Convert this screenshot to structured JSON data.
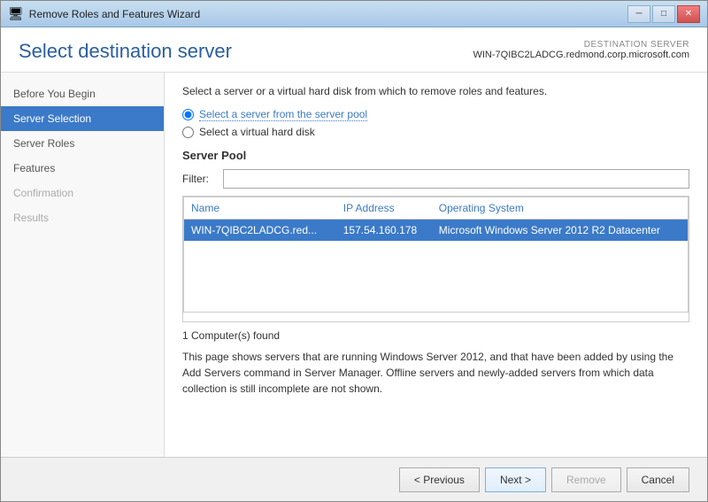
{
  "window": {
    "title": "Remove Roles and Features Wizard",
    "controls": {
      "minimize": "─",
      "maximize": "□",
      "close": "✕"
    }
  },
  "header": {
    "page_title": "Select destination server",
    "destination_label": "DESTINATION SERVER",
    "destination_name": "WIN-7QIBC2LADCG.redmond.corp.microsoft.com"
  },
  "sidebar": {
    "items": [
      {
        "label": "Before You Begin",
        "state": "normal"
      },
      {
        "label": "Server Selection",
        "state": "active"
      },
      {
        "label": "Server Roles",
        "state": "normal"
      },
      {
        "label": "Features",
        "state": "normal"
      },
      {
        "label": "Confirmation",
        "state": "disabled"
      },
      {
        "label": "Results",
        "state": "disabled"
      }
    ]
  },
  "content": {
    "description": "Select a server or a virtual hard disk from which to remove roles and features.",
    "radio_options": [
      {
        "id": "radio-pool",
        "label": "Select a server from the server pool",
        "selected": true
      },
      {
        "id": "radio-vhd",
        "label": "Select a virtual hard disk",
        "selected": false
      }
    ],
    "server_pool_label": "Server Pool",
    "filter_label": "Filter:",
    "filter_placeholder": "",
    "table": {
      "columns": [
        "Name",
        "IP Address",
        "Operating System"
      ],
      "rows": [
        {
          "name": "WIN-7QIBC2LADCG.red...",
          "ip": "157.54.160.178",
          "os": "Microsoft Windows Server 2012 R2 Datacenter",
          "selected": true
        }
      ]
    },
    "found_text": "1 Computer(s) found",
    "info_text": "This page shows servers that are running Windows Server 2012, and that have been added by using the Add Servers command in Server Manager. Offline servers and newly-added servers from which data collection is still incomplete are not shown."
  },
  "footer": {
    "previous_label": "< Previous",
    "next_label": "Next >",
    "remove_label": "Remove",
    "cancel_label": "Cancel"
  }
}
